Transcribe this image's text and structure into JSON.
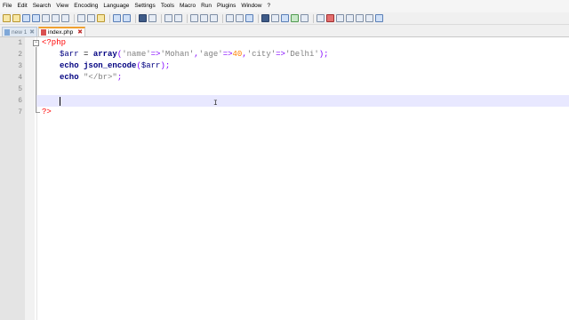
{
  "menu": [
    "File",
    "Edit",
    "Search",
    "View",
    "Encoding",
    "Language",
    "Settings",
    "Tools",
    "Macro",
    "Run",
    "Plugins",
    "Window",
    "?"
  ],
  "tabs": [
    {
      "label": "new 1",
      "active": false
    },
    {
      "label": "index.php",
      "active": true
    }
  ],
  "editor": {
    "line_numbers": [
      "1",
      "2",
      "3",
      "4",
      "5",
      "6",
      "7"
    ],
    "line1": {
      "open": "<?php"
    },
    "line2": {
      "var": "$arr",
      "assign": " = ",
      "func": "array",
      "p1": "(",
      "s1": "'name'",
      "a1": "=>",
      "s2": "'Mohan'",
      "c1": ",",
      "s3": "'age'",
      "a2": "=>",
      "n1": "40",
      "c2": ",",
      "s4": "'city'",
      "a3": "=>",
      "s5": "'Delhi'",
      "p2": ");"
    },
    "line3": {
      "kw": "echo",
      "func": "json_encode",
      "p1": "(",
      "var": "$arr",
      "p2": ");"
    },
    "line4": {
      "kw": "echo",
      "str": "\"</br>\"",
      "end": ";"
    },
    "line7": {
      "close": "?>"
    }
  },
  "colors": {
    "keyword": "#000080",
    "string": "#808080",
    "number": "#ff8000",
    "php_tag": "#ff0000",
    "current_line": "#e8e8ff"
  }
}
